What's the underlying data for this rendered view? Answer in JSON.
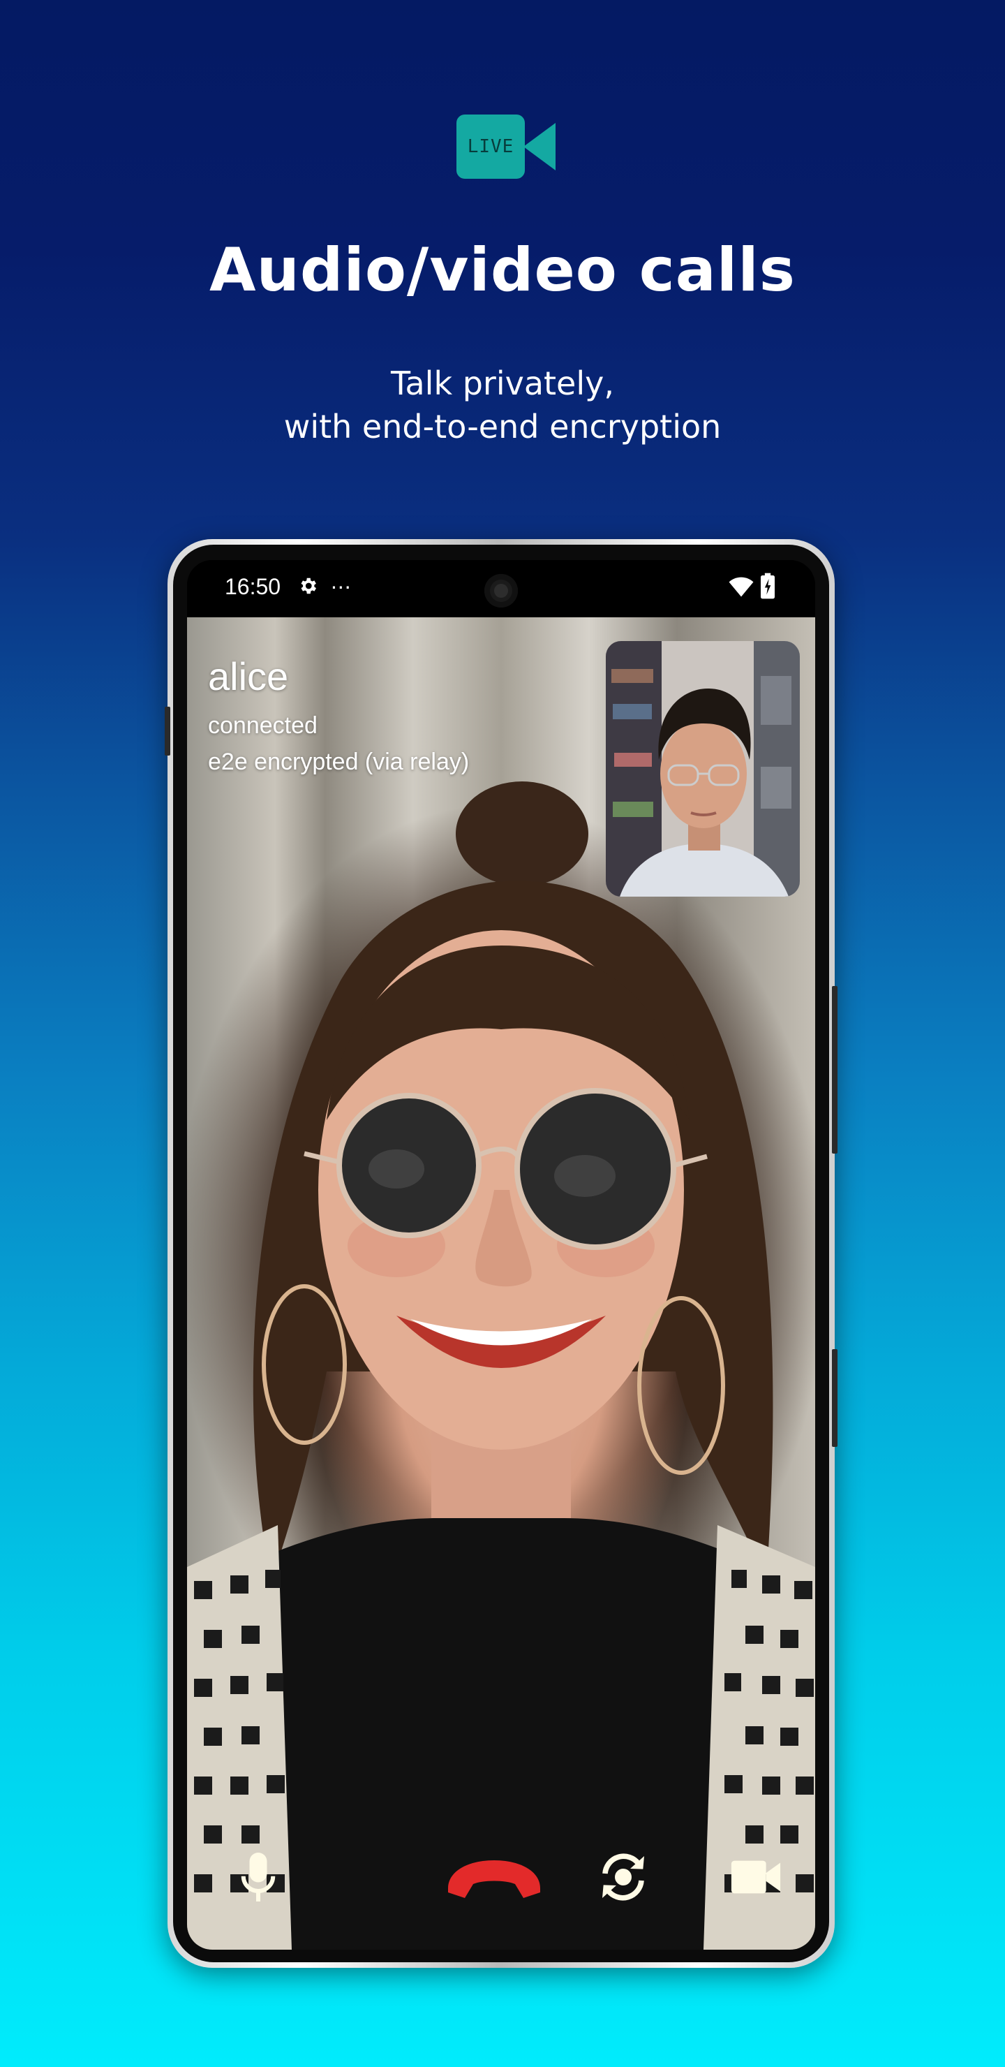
{
  "header": {
    "badge_label": "LIVE",
    "title": "Audio/video calls",
    "subtitle_line1": "Talk privately,",
    "subtitle_line2": "with end-to-end encryption"
  },
  "status_bar": {
    "time": "16:50",
    "overflow": "..."
  },
  "call": {
    "contact_name": "alice",
    "status": "connected",
    "encryption": "e2e encrypted (via relay)"
  },
  "controls": [
    {
      "name": "microphone",
      "icon": "mic-icon"
    },
    {
      "name": "end-call",
      "icon": "phone-hangup-icon",
      "color": "#e32a2a"
    },
    {
      "name": "flip-camera",
      "icon": "camera-switch-icon"
    },
    {
      "name": "video-toggle",
      "icon": "videocam-icon"
    }
  ],
  "colors": {
    "background_top": "#041a63",
    "background_bottom": "#00ecfc",
    "live_badge": "#14a9a2",
    "control_icon": "#fffbe6",
    "end_call": "#e32a2a"
  }
}
